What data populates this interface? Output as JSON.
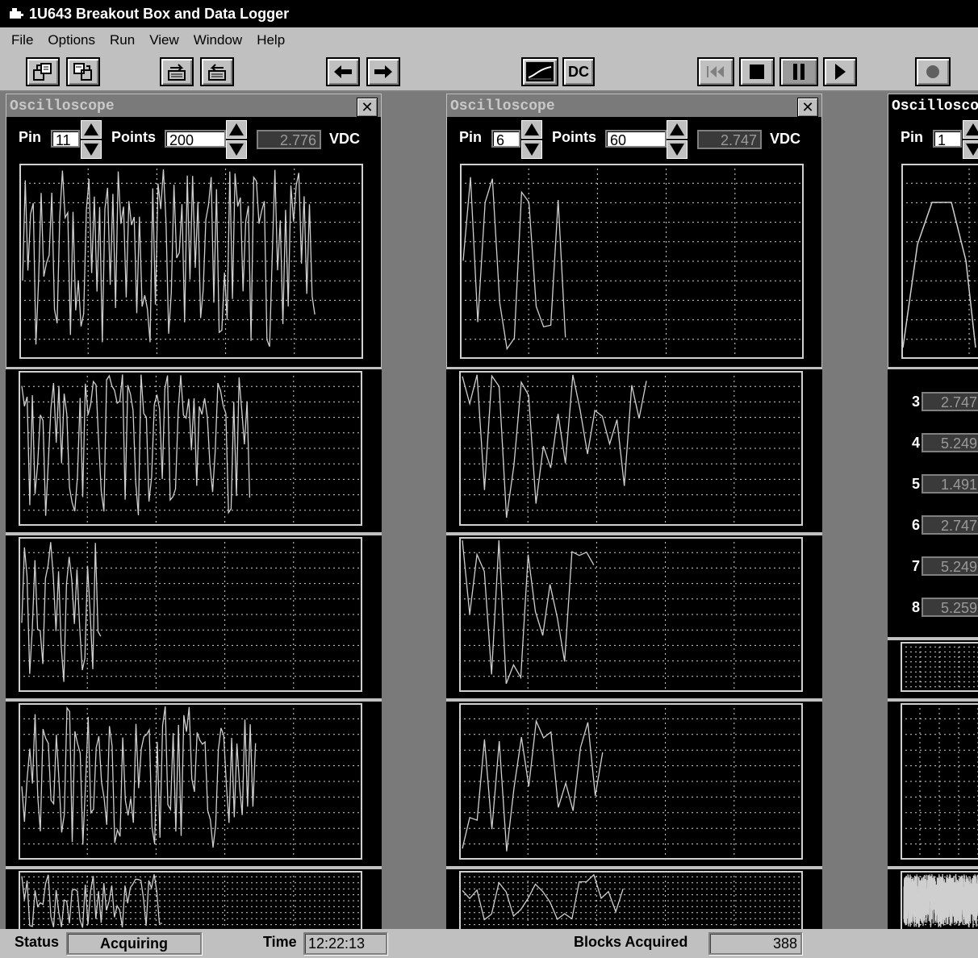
{
  "window": {
    "title": "1U643 Breakout Box and Data Logger"
  },
  "menu": [
    "File",
    "Options",
    "Run",
    "View",
    "Window",
    "Help"
  ],
  "toolbar": {
    "dc_label": "DC",
    "buttons": [
      "open-config-icon",
      "save-config-icon",
      "import-icon",
      "export-icon",
      "arrow-left-icon",
      "arrow-right-icon",
      "scope-trace-icon",
      "dc-button",
      "rewind-icon",
      "stop-icon",
      "pause-icon",
      "play-icon",
      "record-icon"
    ]
  },
  "scopes": [
    {
      "title": "Oscilloscope",
      "pin_label": "Pin",
      "pin": "11",
      "points_label": "Points",
      "points": "200",
      "reading": "2.776",
      "unit": "VDC"
    },
    {
      "title": "Oscilloscope",
      "pin_label": "Pin",
      "pin": "6",
      "points_label": "Points",
      "points": "60",
      "reading": "2.747",
      "unit": "VDC"
    },
    {
      "title": "Oscilloscop",
      "pin_label": "Pin",
      "pin": "1"
    }
  ],
  "readings": [
    {
      "num": "3",
      "value": "2.747"
    },
    {
      "num": "4",
      "value": "5.249"
    },
    {
      "num": "5",
      "value": "1.491"
    },
    {
      "num": "6",
      "value": "2.747"
    },
    {
      "num": "7",
      "value": "5.249"
    },
    {
      "num": "8",
      "value": "5.259"
    }
  ],
  "status": {
    "status_label": "Status",
    "status_value": "Acquiring",
    "time_label": "Time",
    "time_value": "12:22:13",
    "blocks_label": "Blocks Acquired",
    "blocks_value": "388"
  }
}
